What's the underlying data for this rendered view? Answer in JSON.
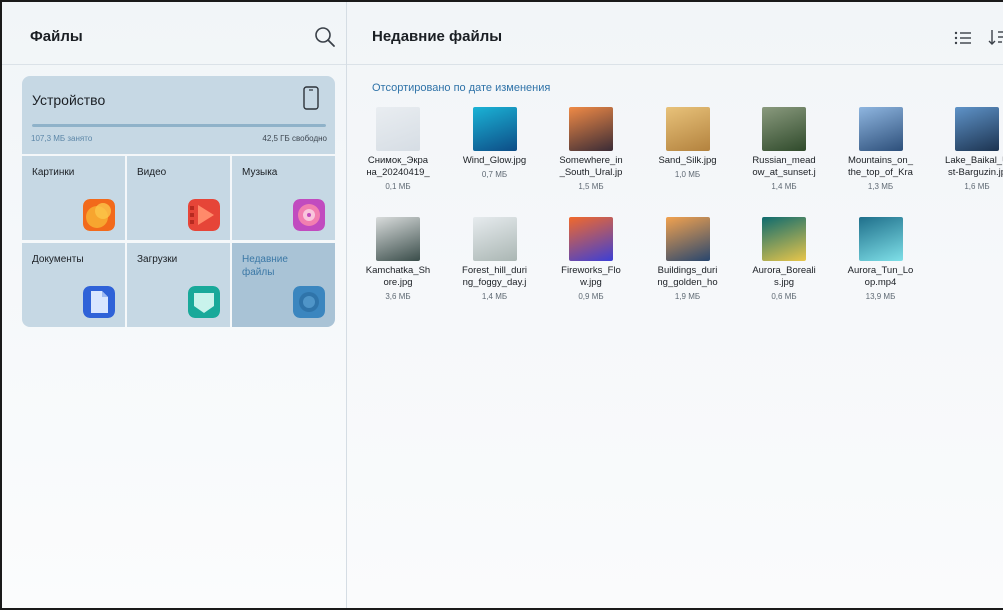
{
  "left_pane": {
    "title": "Файлы",
    "search_icon": "search-icon"
  },
  "storage": {
    "title": "Устройство",
    "used": "107,3 МБ занято",
    "free": "42,5 ГБ свободно",
    "usage_fraction": 0.003
  },
  "categories": [
    {
      "label": "Картинки",
      "icon": "images-icon",
      "color": "#f26a1b"
    },
    {
      "label": "Видео",
      "icon": "video-icon",
      "color": "#e64538"
    },
    {
      "label": "Музыка",
      "icon": "music-icon",
      "color": "#c14bbf"
    },
    {
      "label": "Документы",
      "icon": "document-icon",
      "color": "#2f62d8"
    },
    {
      "label": "Загрузки",
      "icon": "download-icon",
      "color": "#19a99a"
    },
    {
      "label": "Недавние файлы",
      "icon": "recent-icon",
      "color": "#3b86bf",
      "active": true
    }
  ],
  "right_pane": {
    "title": "Недавние файлы",
    "sort_label": "Отсортировано по дате изменения",
    "list_view_icon": "list-view-icon",
    "sort_icon": "sort-icon"
  },
  "files": [
    {
      "name": "Снимок_Экра\nна_20240419_",
      "size": "0,1 МБ",
      "thumb": [
        "#e9edf1",
        "#d6dde4"
      ]
    },
    {
      "name": "Wind_Glow.jpg",
      "size": "0,7 МБ",
      "thumb": [
        "#1bb3d6",
        "#0d4c86"
      ]
    },
    {
      "name": "Somewhere_in\n_South_Ural.jp",
      "size": "1,5 МБ",
      "thumb": [
        "#f08a46",
        "#3a2b36"
      ]
    },
    {
      "name": "Sand_Silk.jpg",
      "size": "1,0 МБ",
      "thumb": [
        "#e8c27a",
        "#b3823e"
      ]
    },
    {
      "name": "Russian_mead\now_at_sunset.j",
      "size": "1,4 МБ",
      "thumb": [
        "#8a9a7e",
        "#2f4a2b"
      ]
    },
    {
      "name": "Mountains_on_\nthe_top_of_Kra",
      "size": "1,3 МБ",
      "thumb": [
        "#8fb6e0",
        "#2d4f7a"
      ]
    },
    {
      "name": "Lake_Baikal_U\nst-Barguzin.jp",
      "size": "1,6 МБ",
      "thumb": [
        "#5f93c8",
        "#1c3350"
      ]
    },
    {
      "name": "Kamchatka_Sh\nore.jpg",
      "size": "3,6 МБ",
      "thumb": [
        "#d9dcdc",
        "#3a4d4a"
      ]
    },
    {
      "name": "Forest_hill_duri\nng_foggy_day.j",
      "size": "1,4 МБ",
      "thumb": [
        "#e6ebee",
        "#aab6b3"
      ]
    },
    {
      "name": "Fireworks_Flo\nw.jpg",
      "size": "0,9 МБ",
      "thumb": [
        "#f2692b",
        "#3c3fd6"
      ]
    },
    {
      "name": "Buildings_duri\nng_golden_ho",
      "size": "1,9 МБ",
      "thumb": [
        "#f2a24f",
        "#28466e"
      ]
    },
    {
      "name": "Aurora_Boreali\ns.jpg",
      "size": "0,6 МБ",
      "thumb": [
        "#0e6b6f",
        "#e9c64a"
      ]
    },
    {
      "name": "Aurora_Tun_Lo\nop.mp4",
      "size": "13,9 МБ",
      "thumb": [
        "#1f6f8b",
        "#7fe0e8"
      ]
    }
  ]
}
